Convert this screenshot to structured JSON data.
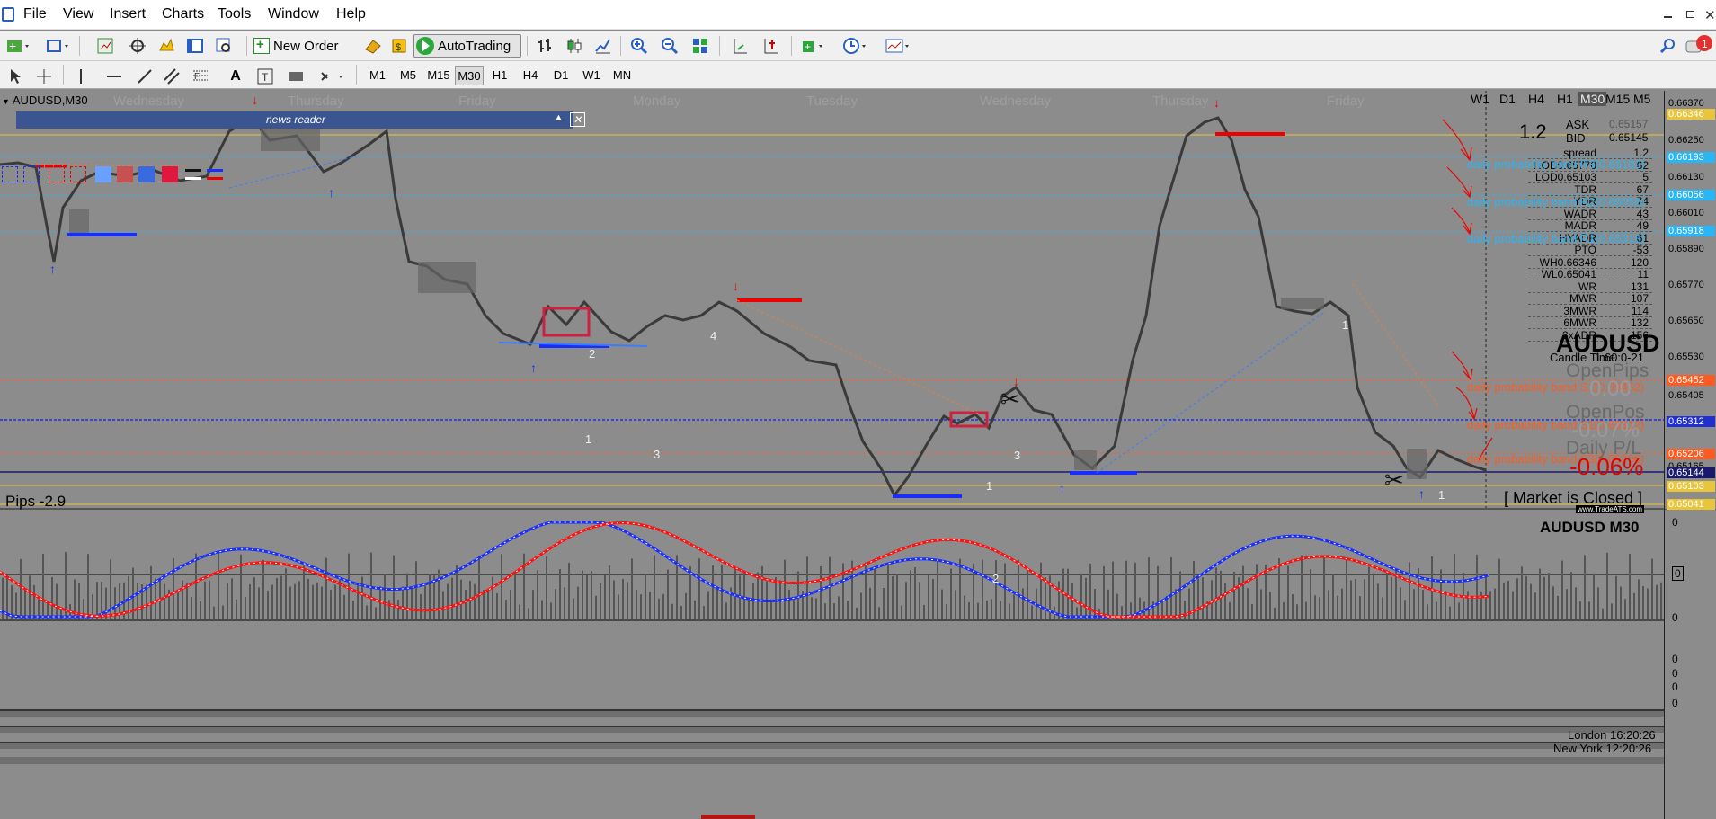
{
  "menu": {
    "items": [
      "File",
      "View",
      "Insert",
      "Charts",
      "Tools",
      "Window",
      "Help"
    ]
  },
  "toolbar": {
    "new_order": "New Order",
    "autotrading": "AutoTrading"
  },
  "timeframes": [
    "M1",
    "M5",
    "M15",
    "M30",
    "H1",
    "H4",
    "D1",
    "W1",
    "MN"
  ],
  "chart": {
    "symbol_header": "AUDUSD,M30",
    "day_labels": [
      "Wednesday",
      "Thursday",
      "Friday",
      "Monday",
      "Tuesday",
      "Wednesday",
      "Thursday",
      "Friday"
    ],
    "news_reader": "news reader",
    "tf_right": [
      "W1",
      "D1",
      "H4",
      "H1",
      "M30",
      "M15",
      "M5"
    ],
    "spread_big": "1.2",
    "ask_label": "ASK",
    "ask_value": "0.65157",
    "bid_label": "BID",
    "bid_value": "0.65145",
    "stats": [
      {
        "label": "spread",
        "value": "1.2"
      },
      {
        "label": "HOD0.65770",
        "value": "62"
      },
      {
        "label": "LOD0.65103",
        "value": "5"
      },
      {
        "label": "TDR",
        "value": "67"
      },
      {
        "label": "YDR",
        "value": "74"
      },
      {
        "label": "WADR",
        "value": "43"
      },
      {
        "label": "MADR",
        "value": "49"
      },
      {
        "label": "HYADR",
        "value": "61"
      },
      {
        "label": "PTO",
        "value": "-53"
      },
      {
        "label": "WH0.66346",
        "value": "120"
      },
      {
        "label": "WL0.65041",
        "value": "11"
      },
      {
        "label": "WR",
        "value": "131"
      },
      {
        "label": "MWR",
        "value": "107"
      },
      {
        "label": "3MWR",
        "value": "114"
      },
      {
        "label": "6MWR",
        "value": "132"
      },
      {
        "label": "3xADR",
        "value": "156"
      }
    ],
    "candle_time_label": "Candle Time",
    "candle_time_value": "1:60:0-21",
    "band_labels": [
      "daily probability band R3(0.66192)",
      "daily probability band R2(0.66056)",
      "daily probability band R1(0.65918)",
      "daily probability band S1(0.65452)",
      "daily probability band S2(0.65312)",
      "daily probability band S3(0.65206)"
    ],
    "symbol_big": "AUDUSD",
    "open_pips_label": "OpenPips",
    "open_pips_value": "0.00",
    "open_pos_label": "OpenPos",
    "open_pos_value": "-0.07%",
    "daily_pl_label": "Daily P/L",
    "daily_pl_value": "-0.06%",
    "pips": "Pips -2.9",
    "market_closed": "[ Market is Closed ]",
    "brand": "www.TradeATS.com",
    "prices": [
      "0.66370",
      "0.66346",
      "0.66250",
      "0.66193",
      "0.66130",
      "0.66056",
      "0.66010",
      "0.65918",
      "0.65890",
      "0.65770",
      "0.65650",
      "0.65530",
      "0.65452",
      "0.65405",
      "0.65312",
      "0.65206",
      "0.65165",
      "0.65144",
      "0.65103",
      "0.65041"
    ],
    "wave_labels": [
      "2",
      "1",
      "3",
      "4",
      "3",
      "1",
      "2",
      "1",
      "1"
    ]
  },
  "indicator": {
    "title": "AUDUSD  M30",
    "scale": [
      "0",
      "0",
      "0",
      "0",
      "0",
      "0",
      "0"
    ],
    "london": "London 16:20:26",
    "new_york": "New York 12:20:26"
  },
  "colors": {
    "background": "#8c8c8c",
    "ask": "#000000",
    "pl_red": "#e00000",
    "band_cyan": "#29b6f6",
    "band_orange": "#ff5a1f",
    "blue_line": "#0000ff",
    "red_line": "#ff0000"
  }
}
